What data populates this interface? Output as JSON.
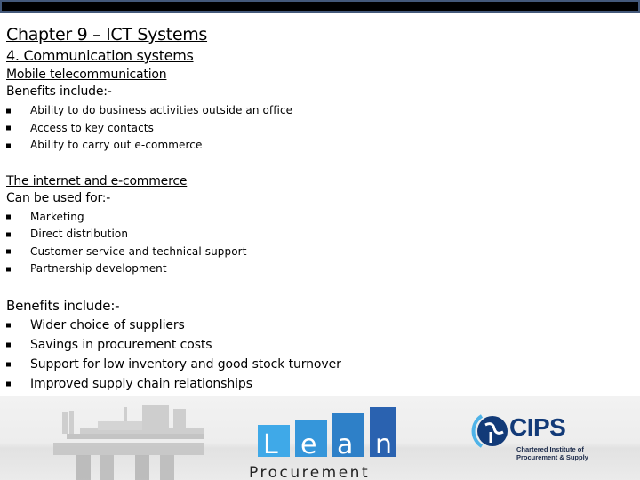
{
  "header": {
    "title": "Chapter 9 – ICT Systems",
    "subtitle": "4. Communication systems"
  },
  "mobile": {
    "heading": "Mobile telecommunication",
    "intro": "Benefits include:-",
    "items": [
      "Ability to do business activities outside an office",
      "Access to key contacts",
      "Ability to carry out e-commerce"
    ]
  },
  "internet": {
    "heading": "The internet and e-commerce",
    "intro": "Can be used for:-",
    "items": [
      "Marketing",
      "Direct distribution",
      "Customer service and technical support",
      "Partnership development"
    ]
  },
  "benefits": {
    "intro": "Benefits include:-",
    "items": [
      "Wider choice of suppliers",
      "Savings in procurement costs",
      "Support for low inventory and good stock turnover",
      "Improved supply chain relationships"
    ]
  },
  "footer": {
    "lean_logo": {
      "letters": [
        "L",
        "e",
        "a",
        "n"
      ],
      "word": "Procurement",
      "colors": [
        "#3fa9e8",
        "#3596da",
        "#2e80c8",
        "#2a62b0"
      ]
    },
    "cips_logo": {
      "name": "CIPS",
      "line1": "Chartered Institute of",
      "line2": "Procurement & Supply",
      "color": "#123a78"
    }
  }
}
